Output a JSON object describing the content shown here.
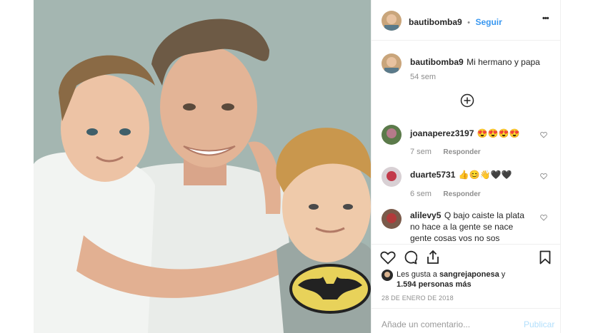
{
  "post": {
    "username": "bautibomba9",
    "follow_label": "Seguir",
    "dot": "•",
    "more_label": "•••",
    "caption": "Mi hermano y papa",
    "caption_time": "54 sem",
    "date": "28 DE ENERO DE 2018",
    "likes_prefix": "Les gusta a",
    "likes_user": "sangrejaponesa",
    "likes_and": "y",
    "likes_count": "1.594 personas más",
    "comment_placeholder": "Añade un comentario...",
    "publish_label": "Publicar"
  },
  "comments": [
    {
      "user": "joanaperez3197",
      "text": "😍😍😍😍",
      "time": "7 sem",
      "reply": "Responder"
    },
    {
      "user": "duarte5731",
      "text": "👍😊👋🖤🖤",
      "time": "6 sem",
      "reply": "Responder"
    },
    {
      "user": "alilevy5",
      "text": "Q bajo caiste la plata no hace a la gente se nace gente cosas vos no sos",
      "time": "",
      "reply": ""
    }
  ],
  "icons": {
    "more": "more-options-icon",
    "load_more": "plus-circle-icon",
    "like": "heart-icon",
    "comment": "comment-icon",
    "share": "share-icon",
    "save": "bookmark-icon"
  }
}
